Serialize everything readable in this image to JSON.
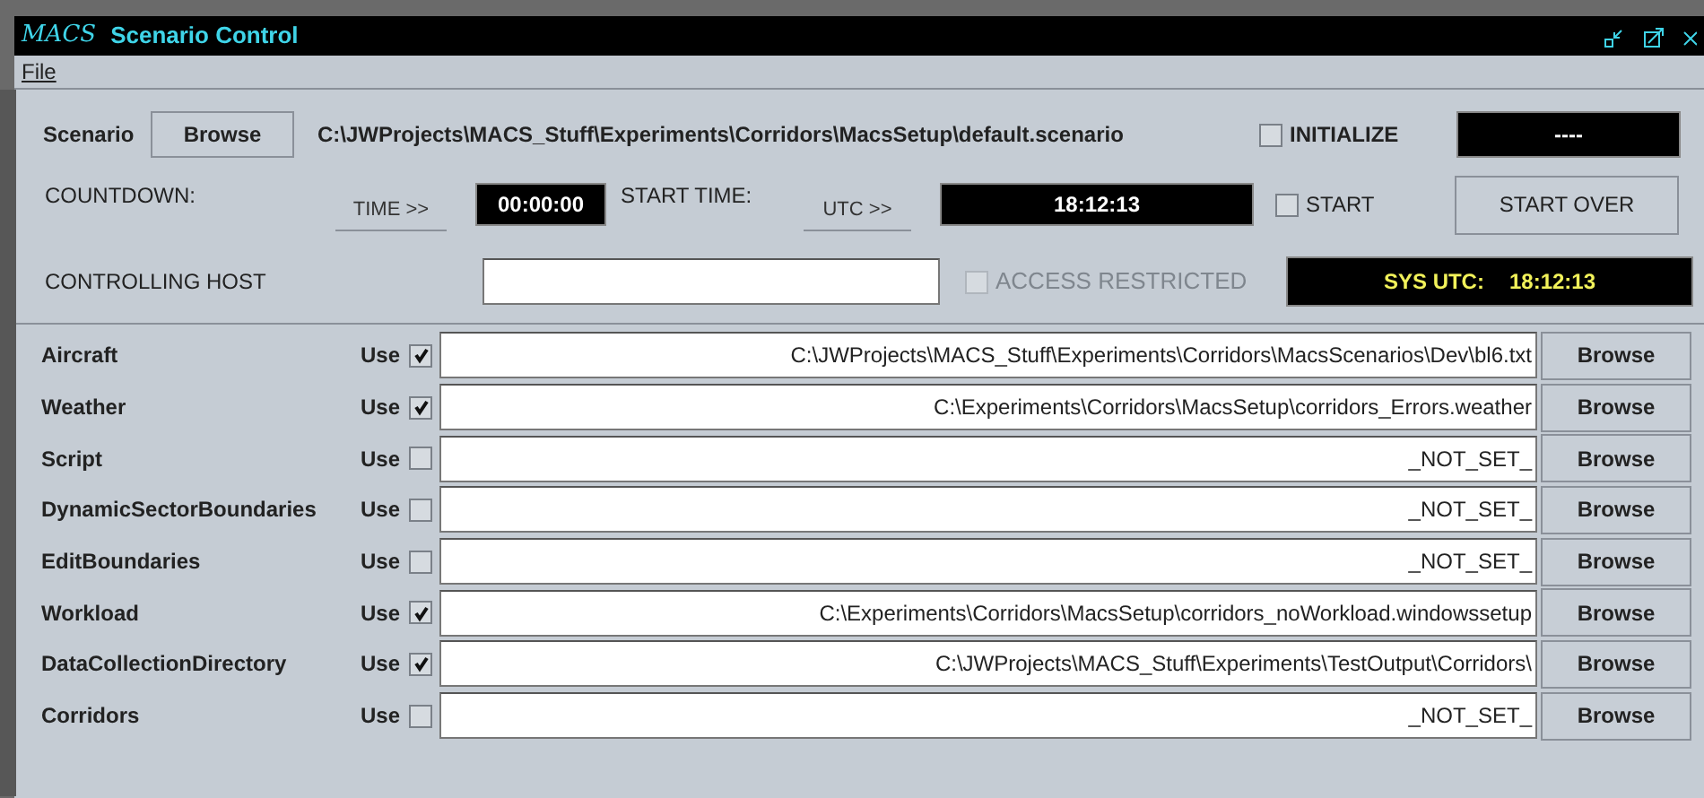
{
  "window": {
    "title": "Scenario Control",
    "logo": "MACS"
  },
  "menu": [
    {
      "label": "File"
    }
  ],
  "scenario": {
    "label": "Scenario",
    "button": "Browse",
    "path": "C:\\JWProjects\\MACS_Stuff\\Experiments\\Corridors\\MacsSetup\\default.scenario"
  },
  "initialize": {
    "label": "INITIALIZE",
    "checked": false,
    "display": "----"
  },
  "countdown": {
    "label": "COUNTDOWN:",
    "button": "TIME >>",
    "display": "00:00:00"
  },
  "start_time": {
    "label": "START TIME:",
    "button": "UTC >>",
    "display": "18:12:13"
  },
  "start": {
    "label": "START",
    "checked": false,
    "button": "START OVER"
  },
  "controlling_host": {
    "label": "CONTROLLING HOST"
  },
  "access_restricted": {
    "label": "ACCESS RESTRICTED",
    "checked": false,
    "disabled": true
  },
  "sys_utc": {
    "label": "SYS UTC:",
    "time": "18:12:13"
  },
  "files": [
    {
      "name": "Aircraft",
      "use_label": "Use",
      "checked": true,
      "path": "C:\\JWProjects\\MACS_Stuff\\Experiments\\Corridors\\MacsScenarios\\Dev\\bl6.txt",
      "button": "Browse"
    },
    {
      "name": "Weather",
      "use_label": "Use",
      "checked": true,
      "path": "C:\\Experiments\\Corridors\\MacsSetup\\corridors_Errors.weather",
      "button": "Browse"
    },
    {
      "name": "Script",
      "use_label": "Use",
      "checked": false,
      "path": "_NOT_SET_",
      "button": "Browse"
    },
    {
      "name": "DynamicSectorBoundaries",
      "use_label": "Use",
      "checked": false,
      "path": "_NOT_SET_",
      "button": "Browse"
    },
    {
      "name": "EditBoundaries",
      "use_label": "Use",
      "checked": false,
      "path": "_NOT_SET_",
      "button": "Browse"
    },
    {
      "name": "Workload",
      "use_label": "Use",
      "checked": true,
      "path": "C:\\Experiments\\Corridors\\MacsSetup\\corridors_noWorkload.windowssetup",
      "button": "Browse"
    },
    {
      "name": "DataCollectionDirectory",
      "use_label": "Use",
      "checked": true,
      "path": "C:\\JWProjects\\MACS_Stuff\\Experiments\\TestOutput\\Corridors\\",
      "button": "Browse"
    },
    {
      "name": "Corridors",
      "use_label": "Use",
      "checked": false,
      "path": "_NOT_SET_",
      "button": "Browse"
    }
  ]
}
